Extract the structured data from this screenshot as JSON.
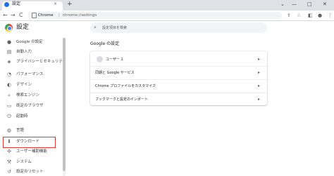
{
  "tab": {
    "title": "設定",
    "close": "×"
  },
  "new_tab": "+",
  "window_controls": {
    "dropdown": "⌄",
    "minimize": "—",
    "maximize": "□",
    "close": "✕"
  },
  "nav": {
    "back": "←",
    "forward": "→",
    "reload": "C"
  },
  "omnibox": {
    "scheme_label": "Chrome",
    "separator": "|",
    "url": "chrome://settings"
  },
  "toolbar_icons": {
    "share": "⇪",
    "bookmark": "☆",
    "split": "◧",
    "profile": "●",
    "menu": "⋮"
  },
  "header": {
    "title": "設定"
  },
  "search": {
    "placeholder": "設定項目を検索"
  },
  "sidebar": {
    "items": [
      {
        "icon": "person-icon",
        "glyph": "●",
        "label": "Google の設定"
      },
      {
        "icon": "autofill-icon",
        "glyph": "▤",
        "label": "自動入力"
      },
      {
        "icon": "shield-icon",
        "glyph": "◈",
        "label": "プライバシーとセキュリティ"
      },
      {
        "icon": "speedometer-icon",
        "glyph": "◔",
        "label": "パフォーマンス"
      },
      {
        "icon": "palette-icon",
        "glyph": "◐",
        "label": "デザイン"
      },
      {
        "icon": "search-icon",
        "glyph": "⌕",
        "label": "検索エンジン"
      },
      {
        "icon": "browser-icon",
        "glyph": "▭",
        "label": "既定のブラウザ"
      },
      {
        "icon": "power-icon",
        "glyph": "⏻",
        "label": "起動時"
      },
      {
        "icon": "globe-icon",
        "glyph": "◍",
        "label": "言語"
      },
      {
        "icon": "download-icon",
        "glyph": "⬇",
        "label": "ダウンロード"
      },
      {
        "icon": "accessibility-icon",
        "glyph": "✣",
        "label": "ユーザー補助機能"
      },
      {
        "icon": "wrench-icon",
        "glyph": "⚒",
        "label": "システム"
      },
      {
        "icon": "reset-icon",
        "glyph": "↺",
        "label": "設定のリセット"
      }
    ]
  },
  "main": {
    "section_title": "Google の設定",
    "rows": [
      {
        "label": "ユーザー 1",
        "arrow": "▸"
      },
      {
        "label": "同期と Google サービス",
        "arrow": "▸"
      },
      {
        "label": "Chrome プロファイルをカスタマイズ",
        "arrow": "▸"
      },
      {
        "label": "ブックマークと設定のインポート",
        "arrow": "▸"
      }
    ]
  },
  "colors": {
    "accent": "#1a73e8",
    "highlight_box": "#e53935",
    "tabstrip": "#dee1e6"
  }
}
